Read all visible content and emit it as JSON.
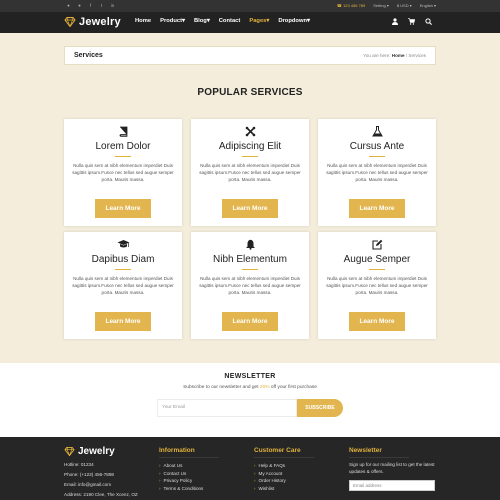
{
  "topbar": {
    "social_icons": [
      "android-icon",
      "apple-icon",
      "facebook-icon",
      "twitter-icon",
      "linkedin-icon"
    ],
    "phone": "123 456 789",
    "settings": "Setting",
    "currency": "USD",
    "language": "English"
  },
  "header": {
    "brand": "Jewelry",
    "nav": [
      "Home",
      "Product",
      "Blog",
      "Contact",
      "Pages",
      "Dropdown"
    ],
    "active_nav": "Pages",
    "icons": [
      "user-icon",
      "cart-icon",
      "search-icon"
    ]
  },
  "breadcrumb": {
    "title": "Services",
    "prefix": "You are here:",
    "home": "Home",
    "separator": "/",
    "current": "Services"
  },
  "section_title": "POPULAR SERVICES",
  "services": [
    {
      "title": "Lorem Dolor",
      "icon": "book-icon",
      "desc": "Nulla quis sem at nibh elementum imperdiet Duis sagittis ipsum.Fusce nec tellus sed augue semper porta. Mauris massa.",
      "button": "Learn More"
    },
    {
      "title": "Adipiscing Elit",
      "icon": "joomla-icon",
      "desc": "Nulla quis sem at nibh elementum imperdiet Duis sagittis ipsum.Fusce nec tellus sed augue semper porta. Mauris massa.",
      "button": "Learn More"
    },
    {
      "title": "Cursus Ante",
      "icon": "flask-icon",
      "desc": "Nulla quis sem at nibh elementum imperdiet Duis sagittis ipsum.Fusce nec tellus sed augue semper porta. Mauris massa.",
      "button": "Learn More"
    },
    {
      "title": "Dapibus Diam",
      "icon": "graduation-cap-icon",
      "desc": "Nulla quis sem at nibh elementum imperdiet Duis sagittis ipsum.Fusce nec tellus sed augue semper porta. Mauris massa.",
      "button": "Learn More"
    },
    {
      "title": "Nibh Elementum",
      "icon": "bell-icon",
      "desc": "Nulla quis sem at nibh elementum imperdiet Duis sagittis ipsum.Fusce nec tellus sed augue semper porta. Mauris massa.",
      "button": "Learn More"
    },
    {
      "title": "Augue Semper",
      "icon": "edit-icon",
      "desc": "Nulla quis sem at nibh elementum imperdiet Duis sagittis ipsum.Fusce nec tellus sed augue semper porta. Mauris massa.",
      "button": "Learn More"
    }
  ],
  "newsletter": {
    "title": "NEWSLETTER",
    "subtitle_pre": "Subscribe to our newsletter and get",
    "subtitle_highlight": "20%",
    "subtitle_post": "off your first purchase",
    "placeholder": "Your Email",
    "button": "SUBSCRIBE"
  },
  "footer": {
    "brand": "Jewelry",
    "contact": [
      "Hotline: 01234",
      "Phone: (+123) 456-7898",
      "Email: info@gmail.com",
      "Address: 2190 Clee, The Xcenz, OZ"
    ],
    "information": {
      "title": "Information",
      "items": [
        "About Us",
        "Contact Us",
        "Privacy Policy",
        "Terms & Conditions"
      ]
    },
    "customer_care": {
      "title": "Customer Care",
      "items": [
        "Help & FAQs",
        "My Account",
        "Order History",
        "Wishlist"
      ]
    },
    "newsletter": {
      "title": "Newsletter",
      "text": "Sign up for our mailing list to get the latest updates & offers.",
      "placeholder": "Email address"
    }
  },
  "colors": {
    "accent": "#e2b13c",
    "band": "#f4eddb",
    "dark": "#222222"
  }
}
